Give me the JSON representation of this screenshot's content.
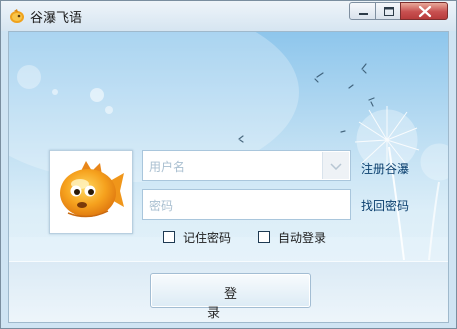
{
  "window": {
    "title": "谷瀑飞语",
    "controls": {
      "minimize": "minimize",
      "maximize": "maximize",
      "close": "close"
    }
  },
  "login": {
    "username_placeholder": "用户名",
    "password_placeholder": "密码",
    "register_link": "注册谷瀑",
    "forgot_link": "找回密码",
    "remember_label": "记住密码",
    "auto_login_label": "自动登录",
    "login_button": "登　录"
  },
  "icons": {
    "app": "fish-logo-icon",
    "avatar": "pufferfish-avatar",
    "dropdown": "chevron-down-icon"
  },
  "colors": {
    "accent": "#8ec6ec",
    "link": "#0b3f6e",
    "close_button": "#c75050"
  }
}
